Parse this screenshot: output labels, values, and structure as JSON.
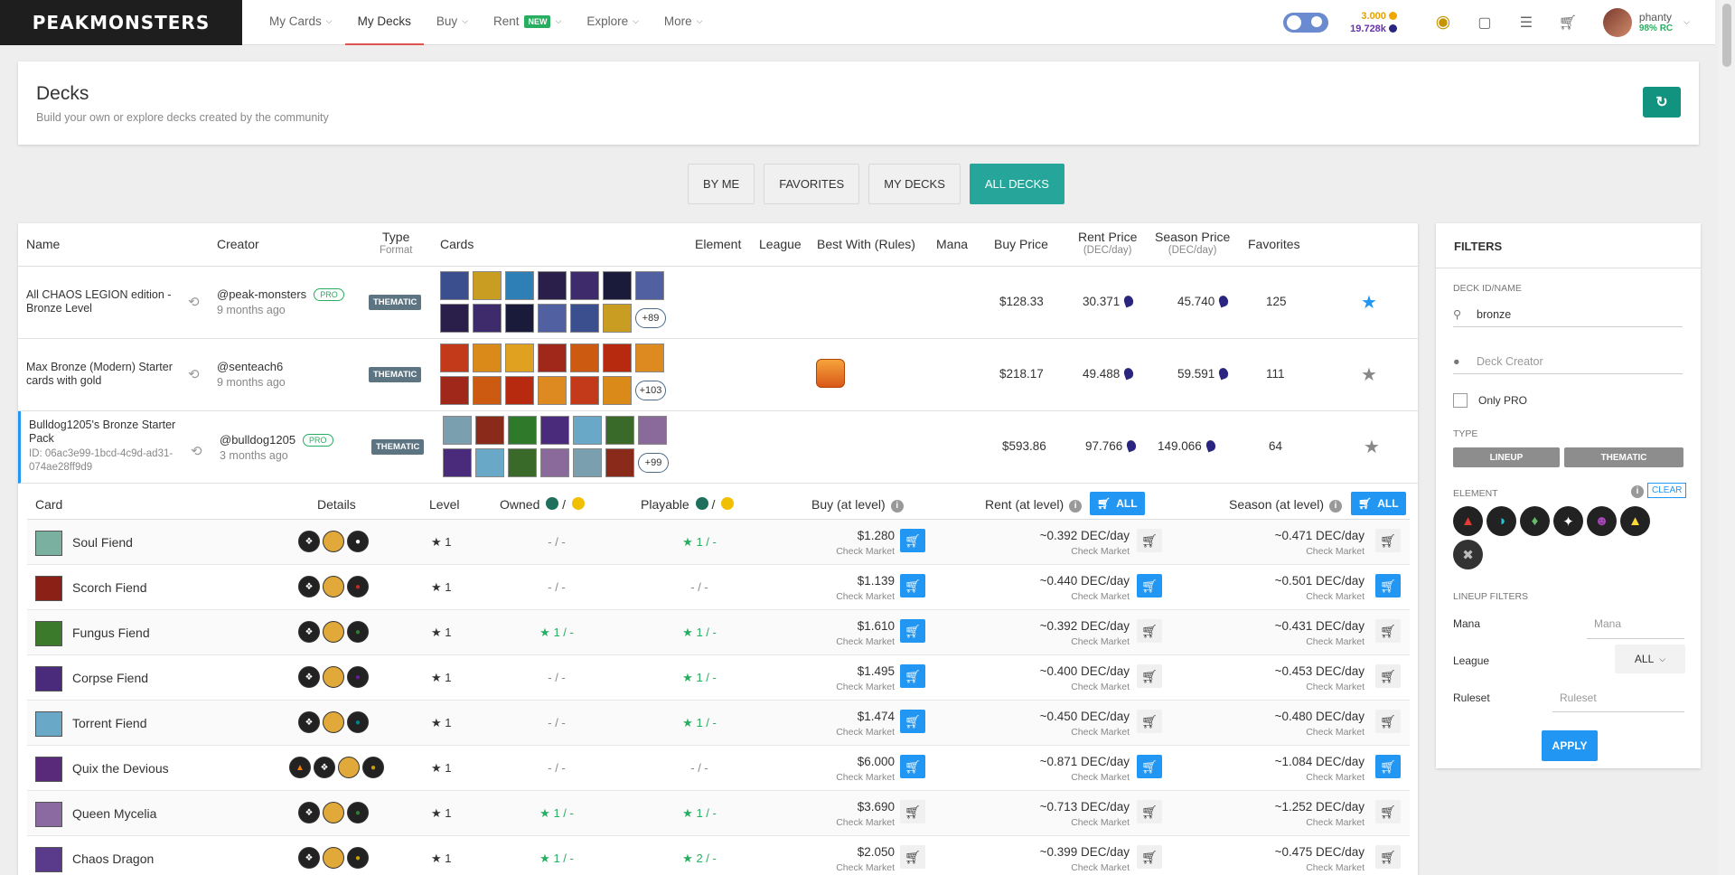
{
  "brand": "PEAKMONSTERS",
  "nav": {
    "items": [
      {
        "label": "My Cards",
        "chevron": true
      },
      {
        "label": "My Decks",
        "active": true
      },
      {
        "label": "Buy",
        "chevron": true
      },
      {
        "label": "Rent",
        "badge": "NEW",
        "chevron": true
      },
      {
        "label": "Explore",
        "chevron": true
      },
      {
        "label": "More",
        "chevron": true
      }
    ],
    "balance_1": "3.000",
    "balance_2": "19.728k",
    "user": "phanty",
    "rc": "98% RC"
  },
  "header": {
    "title": "Decks",
    "subtitle": "Build your own or explore decks created by the community"
  },
  "tabs": [
    "BY ME",
    "FAVORITES",
    "MY DECKS",
    "ALL DECKS"
  ],
  "table": {
    "cols": {
      "name": "Name",
      "creator": "Creator",
      "type": "Type",
      "format": "Format",
      "cards": "Cards",
      "element": "Element",
      "league": "League",
      "best_with": "Best With (Rules)",
      "mana": "Mana",
      "buy_price": "Buy Price",
      "rent_price": "Rent Price",
      "rent_unit": "(DEC/day)",
      "season_price": "Season Price",
      "season_unit": "(DEC/day)",
      "favorites": "Favorites"
    },
    "decks": [
      {
        "name": "All CHAOS LEGION edition - Bronze Level",
        "creator": "@peak-monsters",
        "pro": "PRO",
        "ago": "9 months ago",
        "type": "THEMATIC",
        "more": "+89",
        "buy": "$128.33",
        "rent": "30.371",
        "season": "45.740",
        "favorites": "125"
      },
      {
        "name": "Max Bronze (Modern) Starter cards with gold",
        "creator": "@senteach6",
        "pro": "",
        "ago": "9 months ago",
        "type": "THEMATIC",
        "more": "+103",
        "buy": "$218.17",
        "rent": "49.488",
        "season": "59.591",
        "favorites": "111"
      },
      {
        "name": "Bulldog1205's Bronze Starter Pack",
        "id": "ID: 06ac3e99-1bcd-4c9d-ad31-074ae28ff9d9",
        "creator": "@bulldog1205",
        "pro": "PRO",
        "ago": "3 months ago",
        "type": "THEMATIC",
        "more": "+99",
        "buy": "$593.86",
        "rent": "97.766",
        "season": "149.066",
        "favorites": "64"
      }
    ]
  },
  "inner": {
    "cols": {
      "card": "Card",
      "details": "Details",
      "level": "Level",
      "owned": "Owned",
      "playable": "Playable",
      "buy": "Buy (at level)",
      "rent": "Rent (at level)",
      "season": "Season (at level)",
      "all": "ALL",
      "sep": "/"
    },
    "check_market": "Check Market",
    "rows": [
      {
        "name": "Soul Fiend",
        "level": "1",
        "owned": "- / -",
        "owned_star": false,
        "playable": "1 / -",
        "play_star": true,
        "buy": "$1.280",
        "rent": "~0.392 DEC/day",
        "season": "~0.471 DEC/day",
        "b1": "blue",
        "b2": "plain",
        "b3": "plain",
        "el": "#222"
      },
      {
        "name": "Scorch Fiend",
        "level": "1",
        "owned": "- / -",
        "owned_star": false,
        "playable": "- / -",
        "play_star": false,
        "buy": "$1.139",
        "rent": "~0.440 DEC/day",
        "season": "~0.501 DEC/day",
        "b1": "blue",
        "b2": "blue",
        "b3": "blue",
        "el": "#c62828"
      },
      {
        "name": "Fungus Fiend",
        "level": "1",
        "owned": "1 / -",
        "owned_star": true,
        "playable": "1 / -",
        "play_star": true,
        "buy": "$1.610",
        "rent": "~0.392 DEC/day",
        "season": "~0.431 DEC/day",
        "b1": "blue",
        "b2": "plain",
        "b3": "plain",
        "el": "#2e7d32"
      },
      {
        "name": "Corpse Fiend",
        "level": "1",
        "owned": "- / -",
        "owned_star": false,
        "playable": "1 / -",
        "play_star": true,
        "buy": "$1.495",
        "rent": "~0.400 DEC/day",
        "season": "~0.453 DEC/day",
        "b1": "blue",
        "b2": "plain",
        "b3": "plain",
        "el": "#6a1b9a"
      },
      {
        "name": "Torrent Fiend",
        "level": "1",
        "owned": "- / -",
        "owned_star": false,
        "playable": "1 / -",
        "play_star": true,
        "buy": "$1.474",
        "rent": "~0.450 DEC/day",
        "season": "~0.480 DEC/day",
        "b1": "blue",
        "b2": "plain",
        "b3": "plain",
        "el": "#00838f"
      },
      {
        "name": "Quix the Devious",
        "level": "1",
        "owned": "- / -",
        "owned_star": false,
        "playable": "- / -",
        "play_star": false,
        "buy": "$6.000",
        "rent": "~0.871 DEC/day",
        "season": "~1.084 DEC/day",
        "b1": "blue",
        "b2": "blue",
        "b3": "blue",
        "el": "#c9a100"
      },
      {
        "name": "Queen Mycelia",
        "level": "1",
        "owned": "1 / -",
        "owned_star": true,
        "playable": "1 / -",
        "play_star": true,
        "buy": "$3.690",
        "rent": "~0.713 DEC/day",
        "season": "~1.252 DEC/day",
        "b1": "plain",
        "b2": "plain",
        "b3": "plain",
        "el": "#2e7d32"
      },
      {
        "name": "Chaos Dragon",
        "level": "1",
        "owned": "1 / -",
        "owned_star": true,
        "playable": "2 / -",
        "play_star": true,
        "buy": "$2.050",
        "rent": "~0.399 DEC/day",
        "season": "~0.475 DEC/day",
        "b1": "plain",
        "b2": "plain",
        "b3": "plain",
        "el": "#c9a100"
      }
    ]
  },
  "filters": {
    "title": "FILTERS",
    "deck_label": "DECK ID/NAME",
    "deck_value": "bronze",
    "creator_ph": "Deck Creator",
    "only_pro": "Only PRO",
    "type_label": "TYPE",
    "type_lineup": "LINEUP",
    "type_thematic": "THEMATIC",
    "element_label": "ELEMENT",
    "clear": "CLEAR",
    "lineup_label": "LINEUP FILTERS",
    "mana": "Mana",
    "mana_ph": "Mana",
    "league": "League",
    "league_value": "ALL",
    "ruleset": "Ruleset",
    "ruleset_ph": "Ruleset",
    "apply": "APPLY"
  }
}
